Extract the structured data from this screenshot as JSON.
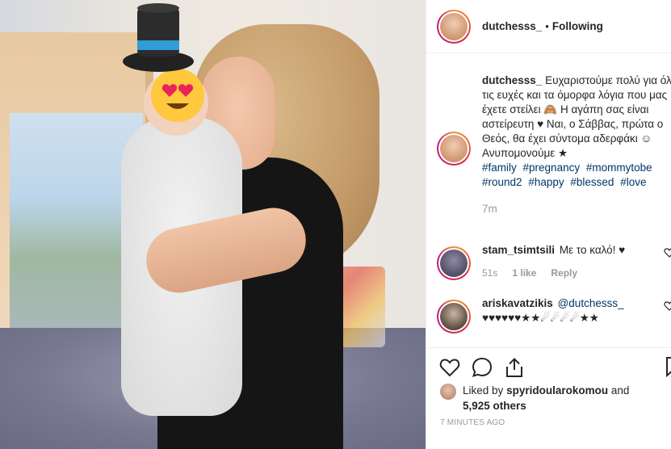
{
  "post": {
    "author": "dutchesss_",
    "separator": "•",
    "follow_status": "Following",
    "caption": "Ευχαριστούμε πολύ για όλες τις ευχές και τα όμορφα λόγια που μας έχετε στείλει 🙈 Η αγάπη σας είναι αστείρευτη ♥ Ναι, ο Σάββας, πρώτα ο Θεός, θα έχει σύντομα αδερφάκι ☺ Ανυπομονούμε ★",
    "hashtags": [
      "#family",
      "#pregnancy",
      "#mommytobe",
      "#round2",
      "#happy",
      "#blessed",
      "#love"
    ],
    "caption_age": "7m"
  },
  "comments": [
    {
      "username": "stam_tsimtsili",
      "text": "Με το καλό! ♥",
      "age": "51s",
      "likes": "1 like",
      "reply": "Reply"
    },
    {
      "username": "ariskavatzikis",
      "mention": "@dutchesss_",
      "text": "♥♥♥♥♥♥★★☄☄☄☄★★"
    }
  ],
  "likes": {
    "prefix": "Liked by",
    "user": "spyridoularokomou",
    "and": "and",
    "count": "5,925 others"
  },
  "posted": "7 MINUTES AGO",
  "icons": {
    "like": "heart-outline-icon",
    "comment": "speech-bubble-icon",
    "share": "share-upload-icon",
    "save": "bookmark-icon",
    "hat": "top-hat-emoji",
    "face": "heart-eyes-emoji"
  },
  "colors": {
    "link": "#003569",
    "muted": "#999999",
    "text": "#262626",
    "border": "#efefef"
  }
}
